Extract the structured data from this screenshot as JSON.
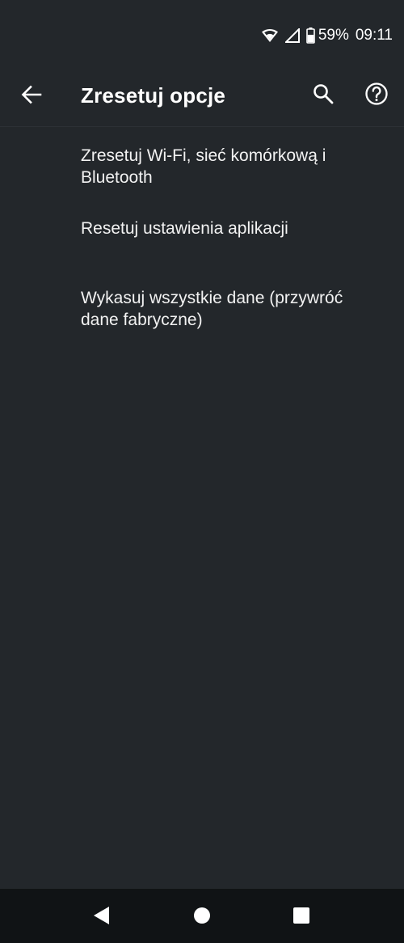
{
  "status_bar": {
    "battery_percent": "59%",
    "time": "09:11",
    "icons": [
      "wifi-icon",
      "cellular-signal-icon",
      "battery-icon"
    ]
  },
  "app_bar": {
    "title": "Zresetuj opcje",
    "icons": [
      "back-arrow-icon",
      "search-icon",
      "help-icon"
    ]
  },
  "options": [
    {
      "label": "Zresetuj Wi-Fi, sieć komórkową i Bluetooth"
    },
    {
      "label": "Resetuj ustawienia aplikacji"
    },
    {
      "label": "Wykasuj wszystkie dane (przywróć dane fabryczne)"
    }
  ],
  "navigation_bar": {
    "icons": [
      "nav-back-icon",
      "nav-home-icon",
      "nav-recents-icon"
    ]
  },
  "colors": {
    "background": "#23272b",
    "nav_bar": "#101315",
    "text": "#ffffff"
  }
}
